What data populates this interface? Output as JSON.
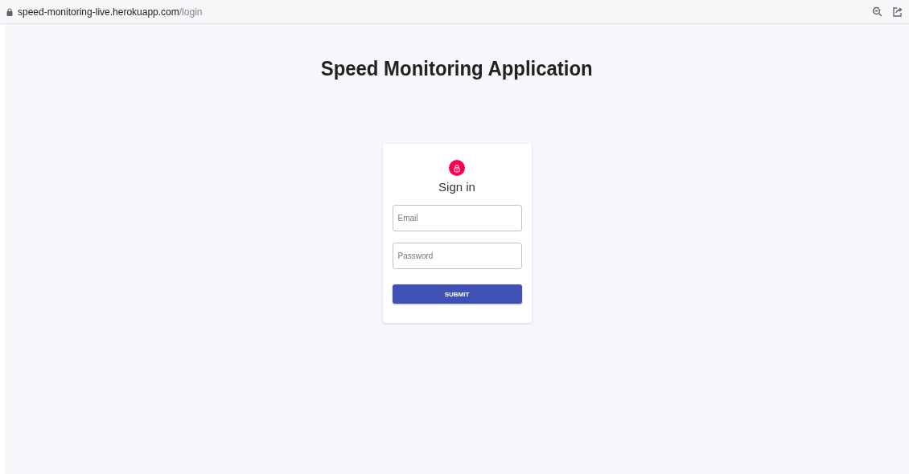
{
  "browser": {
    "address_host": "speed-monitoring-live.herokuapp.com",
    "address_path": "/login"
  },
  "page": {
    "title": "Speed Monitoring Application"
  },
  "login_card": {
    "heading": "Sign in",
    "fields": [
      {
        "placeholder": "Email"
      },
      {
        "placeholder": "Password"
      }
    ],
    "submit_button": "SUBMIT"
  }
}
